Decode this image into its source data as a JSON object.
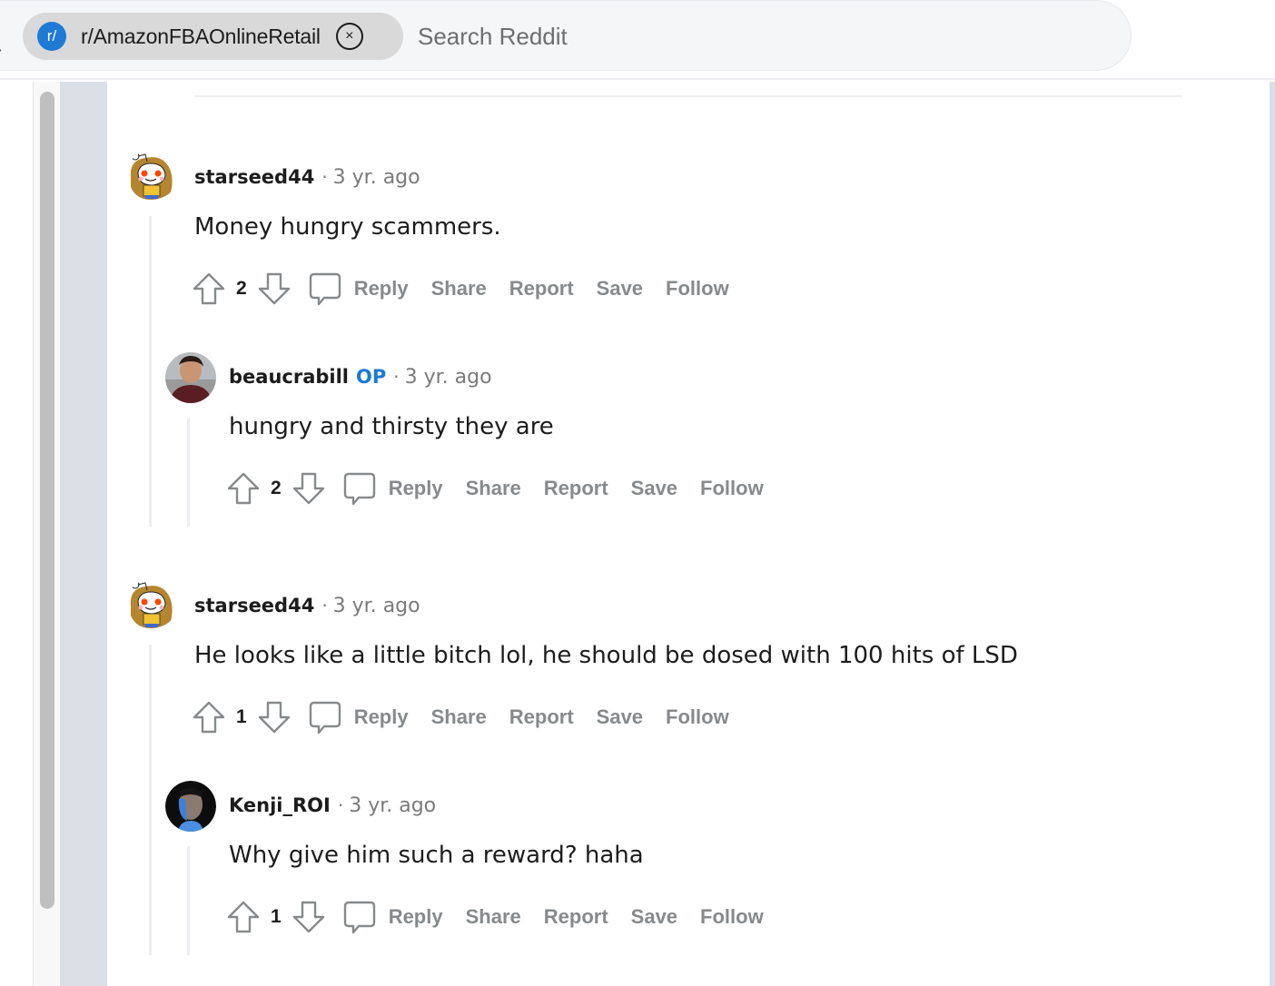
{
  "search": {
    "subreddit_chip": "r/AmazonFBAOnlineRetail",
    "chip_icon_text": "r/",
    "clear_icon": "×",
    "placeholder": "Search Reddit"
  },
  "colors": {
    "accent": "#1a7ad4",
    "op_badge": "#1a7ad4",
    "muted": "#878a8c",
    "text": "#1c1c1c"
  },
  "comments": [
    {
      "username": "starseed44",
      "op": "",
      "separator": "·",
      "time": "3 yr. ago",
      "body": "Money hungry scammers.",
      "score": "2",
      "avatar": "snoo-avatar-starseed44",
      "actions": [
        "Reply",
        "Share",
        "Report",
        "Save",
        "Follow"
      ]
    },
    {
      "username": "beaucrabill",
      "op": "OP",
      "separator": "·",
      "time": "3 yr. ago",
      "body": "hungry and thirsty they are",
      "score": "2",
      "avatar": "photo-avatar-beaucrabill",
      "actions": [
        "Reply",
        "Share",
        "Report",
        "Save",
        "Follow"
      ]
    },
    {
      "username": "starseed44",
      "op": "",
      "separator": "·",
      "time": "3 yr. ago",
      "body": "He looks like a little bitch lol, he should be dosed with 100 hits of LSD",
      "score": "1",
      "avatar": "snoo-avatar-starseed44",
      "actions": [
        "Reply",
        "Share",
        "Report",
        "Save",
        "Follow"
      ]
    },
    {
      "username": "Kenji_ROI",
      "op": "",
      "separator": "·",
      "time": "3 yr. ago",
      "body": "Why give him such a reward? haha",
      "score": "1",
      "avatar": "photo-avatar-kenji",
      "actions": [
        "Reply",
        "Share",
        "Report",
        "Save",
        "Follow"
      ]
    }
  ]
}
